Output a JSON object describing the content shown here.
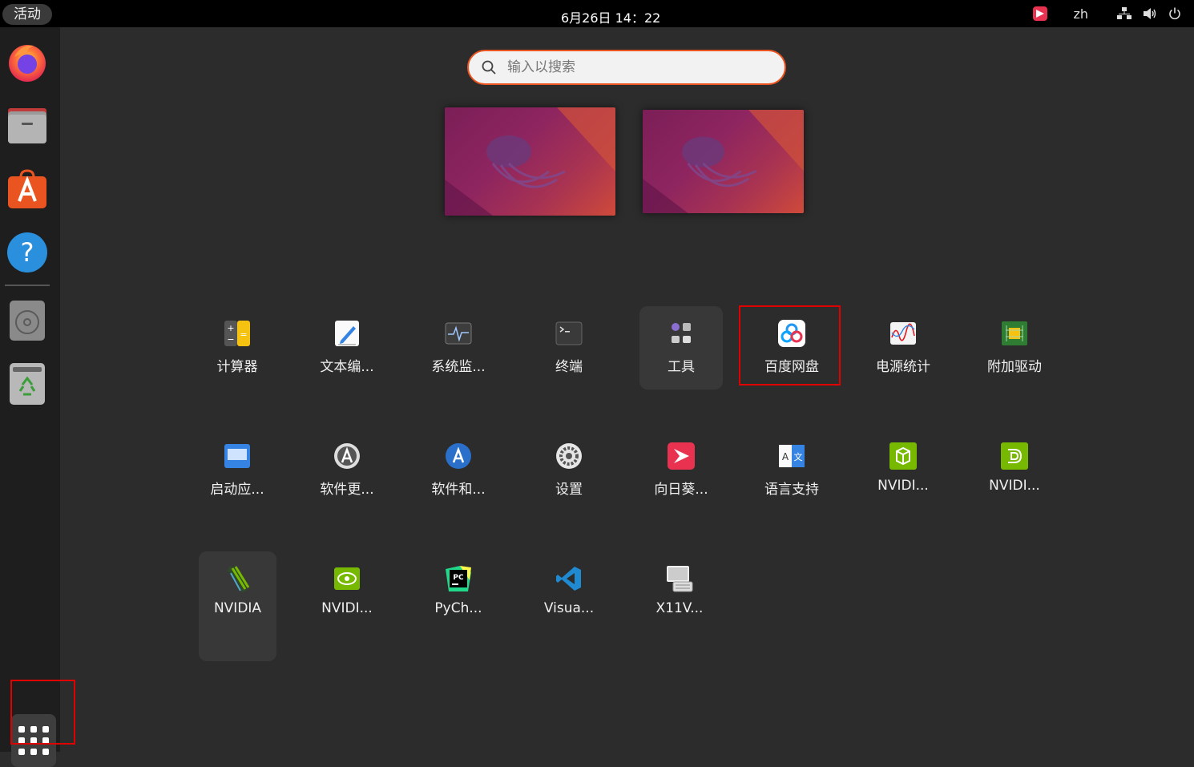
{
  "topbar": {
    "activities": "活动",
    "clock": "6月26日 14：22",
    "lang": "zh",
    "icons": [
      "sunlogin-icon",
      "network-icon",
      "volume-icon",
      "power-icon"
    ]
  },
  "dock": {
    "items": [
      {
        "name": "Firefox",
        "icon": "firefox-icon"
      },
      {
        "name": "Files",
        "icon": "files-icon"
      },
      {
        "name": "Ubuntu Software",
        "icon": "software-icon"
      },
      {
        "name": "Help",
        "icon": "help-icon"
      },
      {
        "name": "Disk",
        "icon": "disk-icon"
      },
      {
        "name": "Trash",
        "icon": "trash-icon"
      }
    ],
    "show_apps_icon": "grid-icon"
  },
  "search": {
    "placeholder": "输入以搜索"
  },
  "workspaces": [
    "workspace-1",
    "workspace-2"
  ],
  "apps": [
    {
      "label": "计算器",
      "icon": "calculator-icon"
    },
    {
      "label": "文本编...",
      "icon": "text-editor-icon"
    },
    {
      "label": "系统监...",
      "icon": "system-monitor-icon"
    },
    {
      "label": "终端",
      "icon": "terminal-icon"
    },
    {
      "label": "工具",
      "icon": "utilities-folder-icon"
    },
    {
      "label": "百度网盘",
      "icon": "baidu-netdisk-icon"
    },
    {
      "label": "电源统计",
      "icon": "power-statistics-icon"
    },
    {
      "label": "附加驱动",
      "icon": "additional-drivers-icon"
    },
    {
      "label": "启动应...",
      "icon": "startup-apps-icon"
    },
    {
      "label": "软件更...",
      "icon": "software-updater-icon"
    },
    {
      "label": "软件和...",
      "icon": "software-sources-icon"
    },
    {
      "label": "设置",
      "icon": "settings-icon"
    },
    {
      "label": "向日葵...",
      "icon": "sunlogin-icon"
    },
    {
      "label": "语言支持",
      "icon": "language-support-icon"
    },
    {
      "label": "NVIDI...",
      "icon": "nvidia-icon"
    },
    {
      "label": "NVIDI...",
      "icon": "nvidia-icon"
    },
    {
      "label": "NVIDIA",
      "icon": "nvidia-folder-icon"
    },
    {
      "label": "NVIDI...",
      "icon": "nvidia-icon"
    },
    {
      "label": "PyCh...",
      "icon": "pycharm-icon"
    },
    {
      "label": "Visua...",
      "icon": "vscode-icon"
    },
    {
      "label": "X11V...",
      "icon": "x11vnc-icon"
    }
  ],
  "colors": {
    "accent": "#e95420",
    "highlight_box": "#e00000",
    "background": "#2c2c2c"
  }
}
